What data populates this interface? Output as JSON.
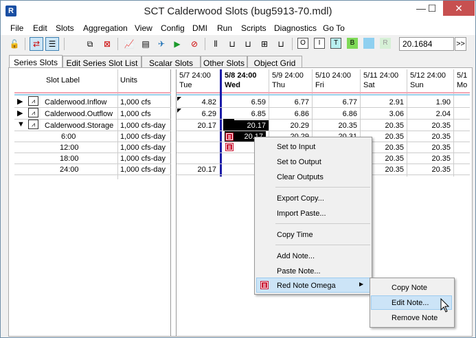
{
  "window": {
    "title": "SCT Calderwood Slots (bug5913-70.mdl)",
    "minimize": "—",
    "maximize": "☐",
    "close": "✕"
  },
  "menubar": [
    "File",
    "Edit",
    "Slots",
    "Aggregation",
    "View",
    "Config",
    "DMI",
    "Run",
    "Scripts",
    "Diagnostics",
    "Go To"
  ],
  "toolbar": {
    "timestep_value": "20.1684",
    "more": ">>",
    "letters": [
      "O",
      "I",
      "T",
      "B",
      "M",
      "D",
      "R"
    ]
  },
  "tabs": [
    "Series Slots",
    "Edit Series Slot List",
    "Scalar Slots",
    "Other Slots",
    "Object Grid"
  ],
  "left": {
    "col_label": "Slot Label",
    "col_units": "Units",
    "rows": [
      {
        "label": "Calderwood.Inflow",
        "units": "1,000 cfs"
      },
      {
        "label": "Calderwood.Outflow",
        "units": "1,000 cfs"
      },
      {
        "label": "Calderwood.Storage",
        "units": "1,000 cfs-day"
      },
      {
        "label": "6:00",
        "units": "1,000 cfs-day"
      },
      {
        "label": "12:00",
        "units": "1,000 cfs-day"
      },
      {
        "label": "18:00",
        "units": "1,000 cfs-day"
      },
      {
        "label": "24:00",
        "units": "1,000 cfs-day"
      }
    ]
  },
  "columns": [
    {
      "date": "5/7 24:00",
      "day": "Tue"
    },
    {
      "date": "5/8 24:00",
      "day": "Wed"
    },
    {
      "date": "5/9 24:00",
      "day": "Thu"
    },
    {
      "date": "5/10 24:00",
      "day": "Fri"
    },
    {
      "date": "5/11 24:00",
      "day": "Sat"
    },
    {
      "date": "5/12 24:00",
      "day": "Sun"
    },
    {
      "date": "5/1",
      "day": "Mo"
    }
  ],
  "grid": [
    [
      "4.82",
      "6.59",
      "6.77",
      "6.77",
      "2.91",
      "1.90"
    ],
    [
      "6.29",
      "6.85",
      "6.86",
      "6.86",
      "3.06",
      "2.04"
    ],
    [
      "20.17",
      "20.17",
      "20.29",
      "20.35",
      "20.35",
      "20.35"
    ],
    [
      "",
      "20.17",
      "20.29",
      "20.31",
      "20.35",
      "20.35"
    ],
    [
      "",
      "20",
      "",
      "",
      "20.35",
      "20.35"
    ],
    [
      "",
      "20",
      "",
      "",
      "20.35",
      "20.35"
    ],
    [
      "20.17",
      "20",
      "",
      "",
      "20.35",
      "20.35"
    ]
  ],
  "context_menu": {
    "items": [
      "Set to Input",
      "Set to Output",
      "Clear Outputs",
      "Export Copy...",
      "Import Paste...",
      "Copy Time",
      "Add Note...",
      "Paste Note...",
      "Red Note Omega"
    ]
  },
  "submenu": {
    "items": [
      "Copy Note",
      "Edit Note...",
      "Remove Note"
    ]
  }
}
